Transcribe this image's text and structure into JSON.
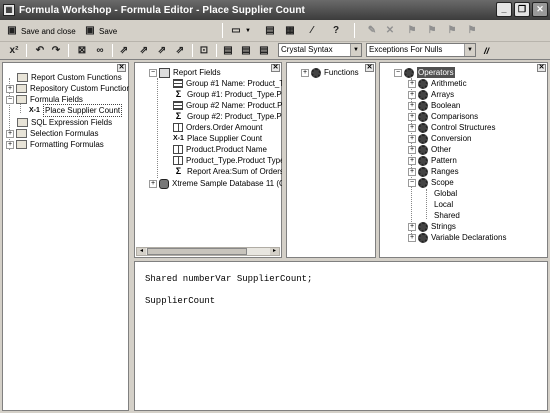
{
  "window": {
    "title": "Formula Workshop - Formula Editor - Place Supplier Count",
    "buttons": [
      "_",
      "❐",
      "✕"
    ]
  },
  "toolbar1": {
    "save_close_label": "Save and close",
    "save_label": "Save",
    "help_label": "?"
  },
  "toolbar2": {
    "syntax": "Crystal Syntax",
    "null_handling": "Exceptions For Nulls",
    "comment_label": "//"
  },
  "workshop_tree": {
    "items": [
      {
        "label": "Report Custom Functions",
        "expander": ""
      },
      {
        "label": "Repository Custom Function",
        "expander": "+"
      },
      {
        "label": "Formula Fields",
        "expander": "−"
      },
      {
        "label": "Place Supplier Count",
        "expander": ""
      },
      {
        "label": "SQL Expression Fields",
        "expander": ""
      },
      {
        "label": "Selection Formulas",
        "expander": "+"
      },
      {
        "label": "Formatting Formulas",
        "expander": "+"
      }
    ]
  },
  "fields_tree": {
    "root": "Report Fields",
    "items": [
      "Group #1 Name: Product_T",
      "Group #1: Product_Type.Pro",
      "Group #2 Name: Product.Pr",
      "Group #2: Product_Type.Product I",
      "Orders.Order Amount",
      "Place Supplier Count",
      "Product.Product Name",
      "Product_Type.Product Type",
      "Report Area:Sum of Orders.O"
    ],
    "database": "Xtreme Sample Database 11 (OD"
  },
  "functions_tree": {
    "root": "Functions"
  },
  "operators_tree": {
    "root": "Operators",
    "items": [
      "Arithmetic",
      "Arrays",
      "Boolean",
      "Comparisons",
      "Control Structures",
      "Conversion",
      "Other",
      "Pattern",
      "Ranges",
      "Scope"
    ],
    "scope_children": [
      "Global",
      "Local",
      "Shared"
    ],
    "after": [
      "Strings",
      "Variable Declarations"
    ]
  },
  "editor": {
    "lines": [
      "Shared numberVar SupplierCount;",
      "",
      "SupplierCount"
    ]
  }
}
